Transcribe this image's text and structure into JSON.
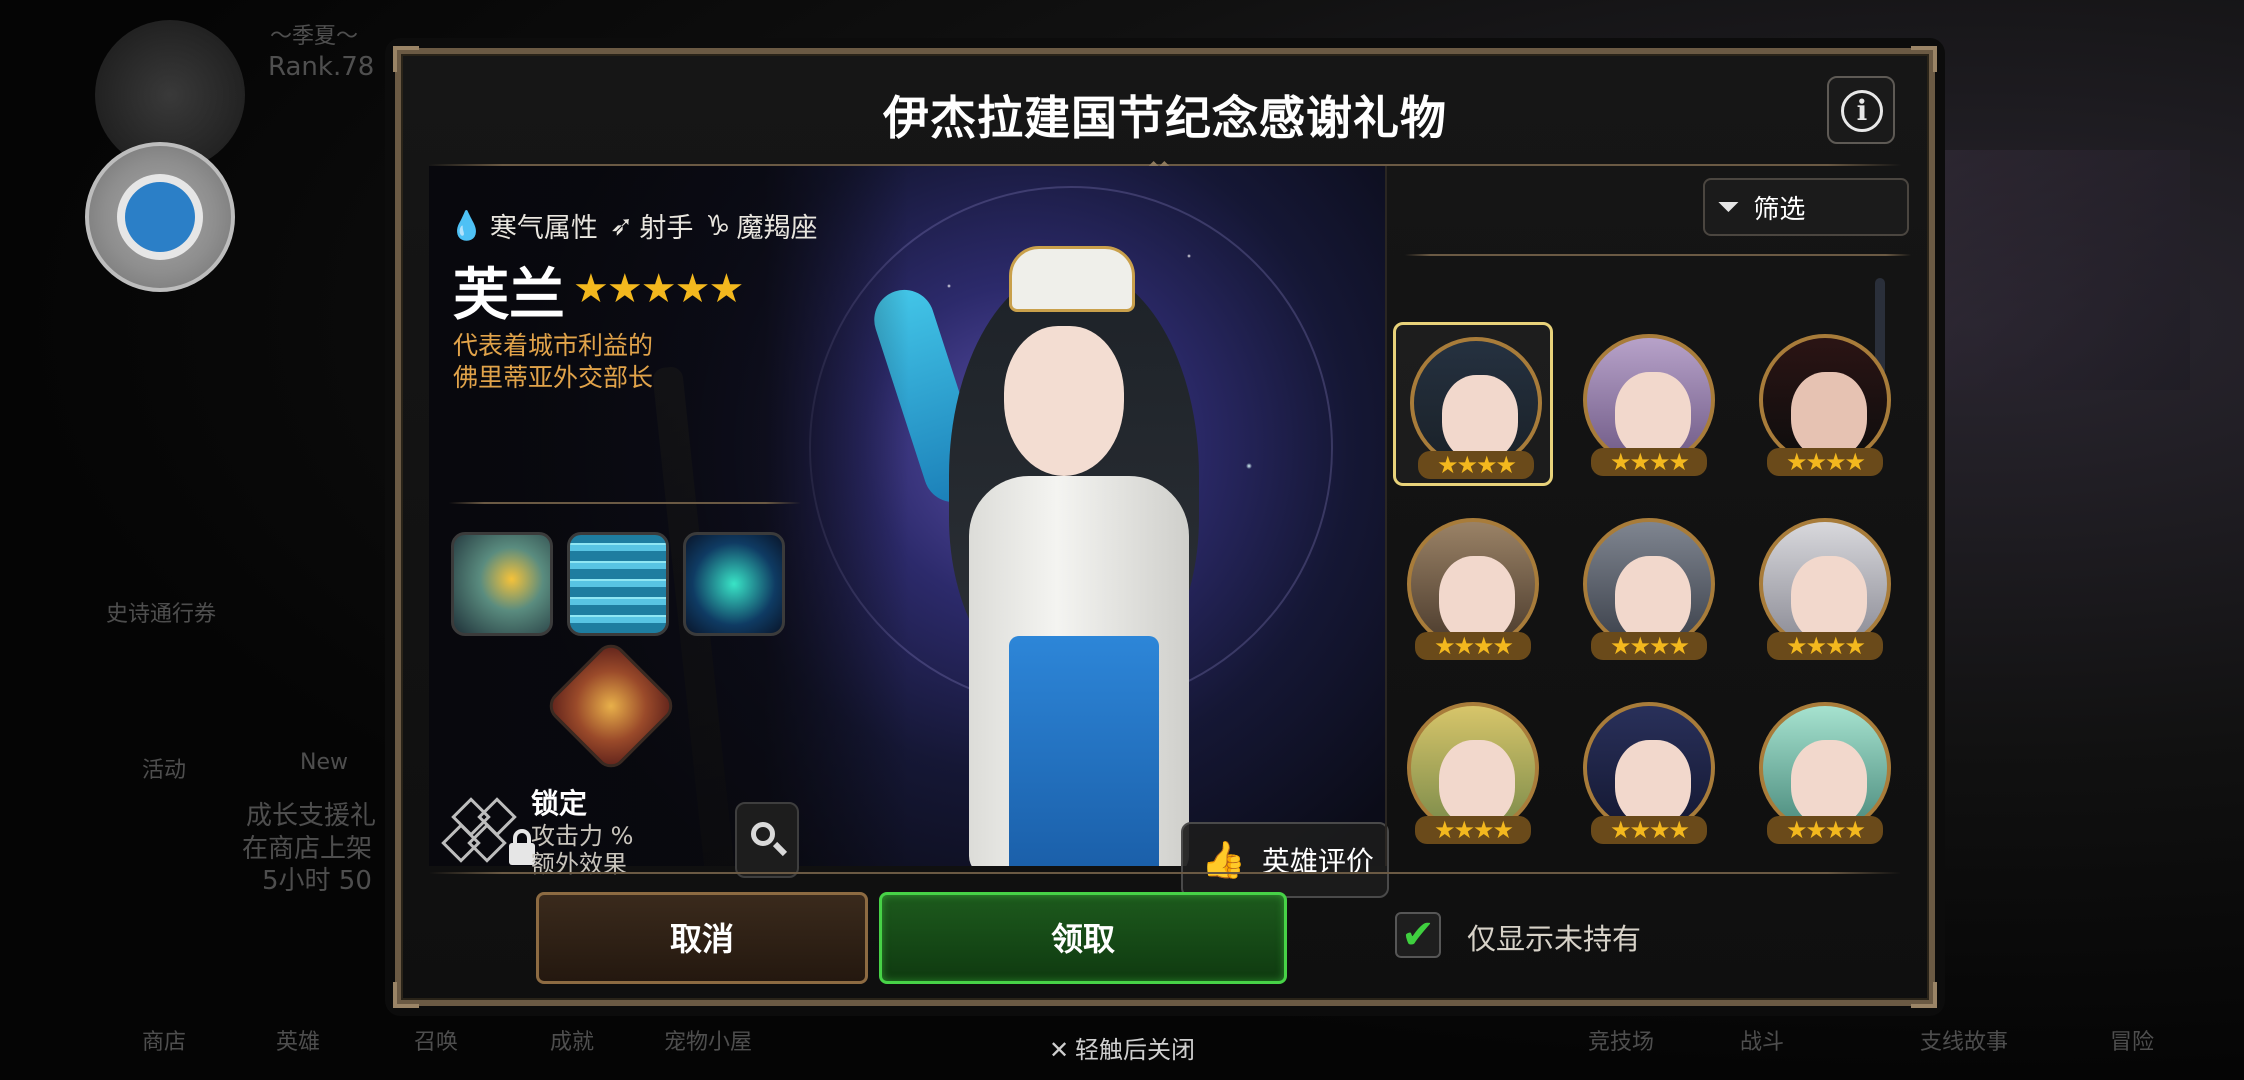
{
  "background": {
    "labels": [
      "～季夏～",
      "Rank.78",
      "史诗通行券",
      "活动",
      "New",
      "成长支援礼",
      "在商店上架",
      "5小时 50",
      "商店",
      "英雄",
      "召唤",
      "成就",
      "宠物小屋",
      "竞技场",
      "战斗",
      "支线故事",
      "冒险"
    ]
  },
  "dialog": {
    "title": "伊杰拉建国节纪念感谢礼物",
    "info_icon": "info-icon",
    "hero": {
      "element": "寒气属性",
      "class": "射手",
      "horoscope": "魔羯座",
      "name": "芙兰",
      "stars": "★★★★★",
      "description_line1": "代表着城市利益的",
      "description_line2": "佛里蒂亚外交部长",
      "exclusive_title": "锁定",
      "exclusive_line1": "攻击力 %",
      "exclusive_line2": "额外效果",
      "rate_label": "英雄评价"
    },
    "filter_label": "筛选",
    "grid_stars": "★★★★",
    "heroes": [
      {
        "selected": true
      },
      {
        "selected": false
      },
      {
        "selected": false
      },
      {
        "selected": false
      },
      {
        "selected": false
      },
      {
        "selected": false
      },
      {
        "selected": false
      },
      {
        "selected": false
      },
      {
        "selected": false
      }
    ],
    "cancel_label": "取消",
    "claim_label": "领取",
    "only_unowned_label": "仅显示未持有",
    "only_unowned_checked": true
  },
  "close_hint": "轻触后关闭",
  "colors": {
    "accent_gold": "#e1a34a",
    "star": "#f3b81e",
    "claim_green": "#47d247",
    "frame": "#6b5a44"
  }
}
